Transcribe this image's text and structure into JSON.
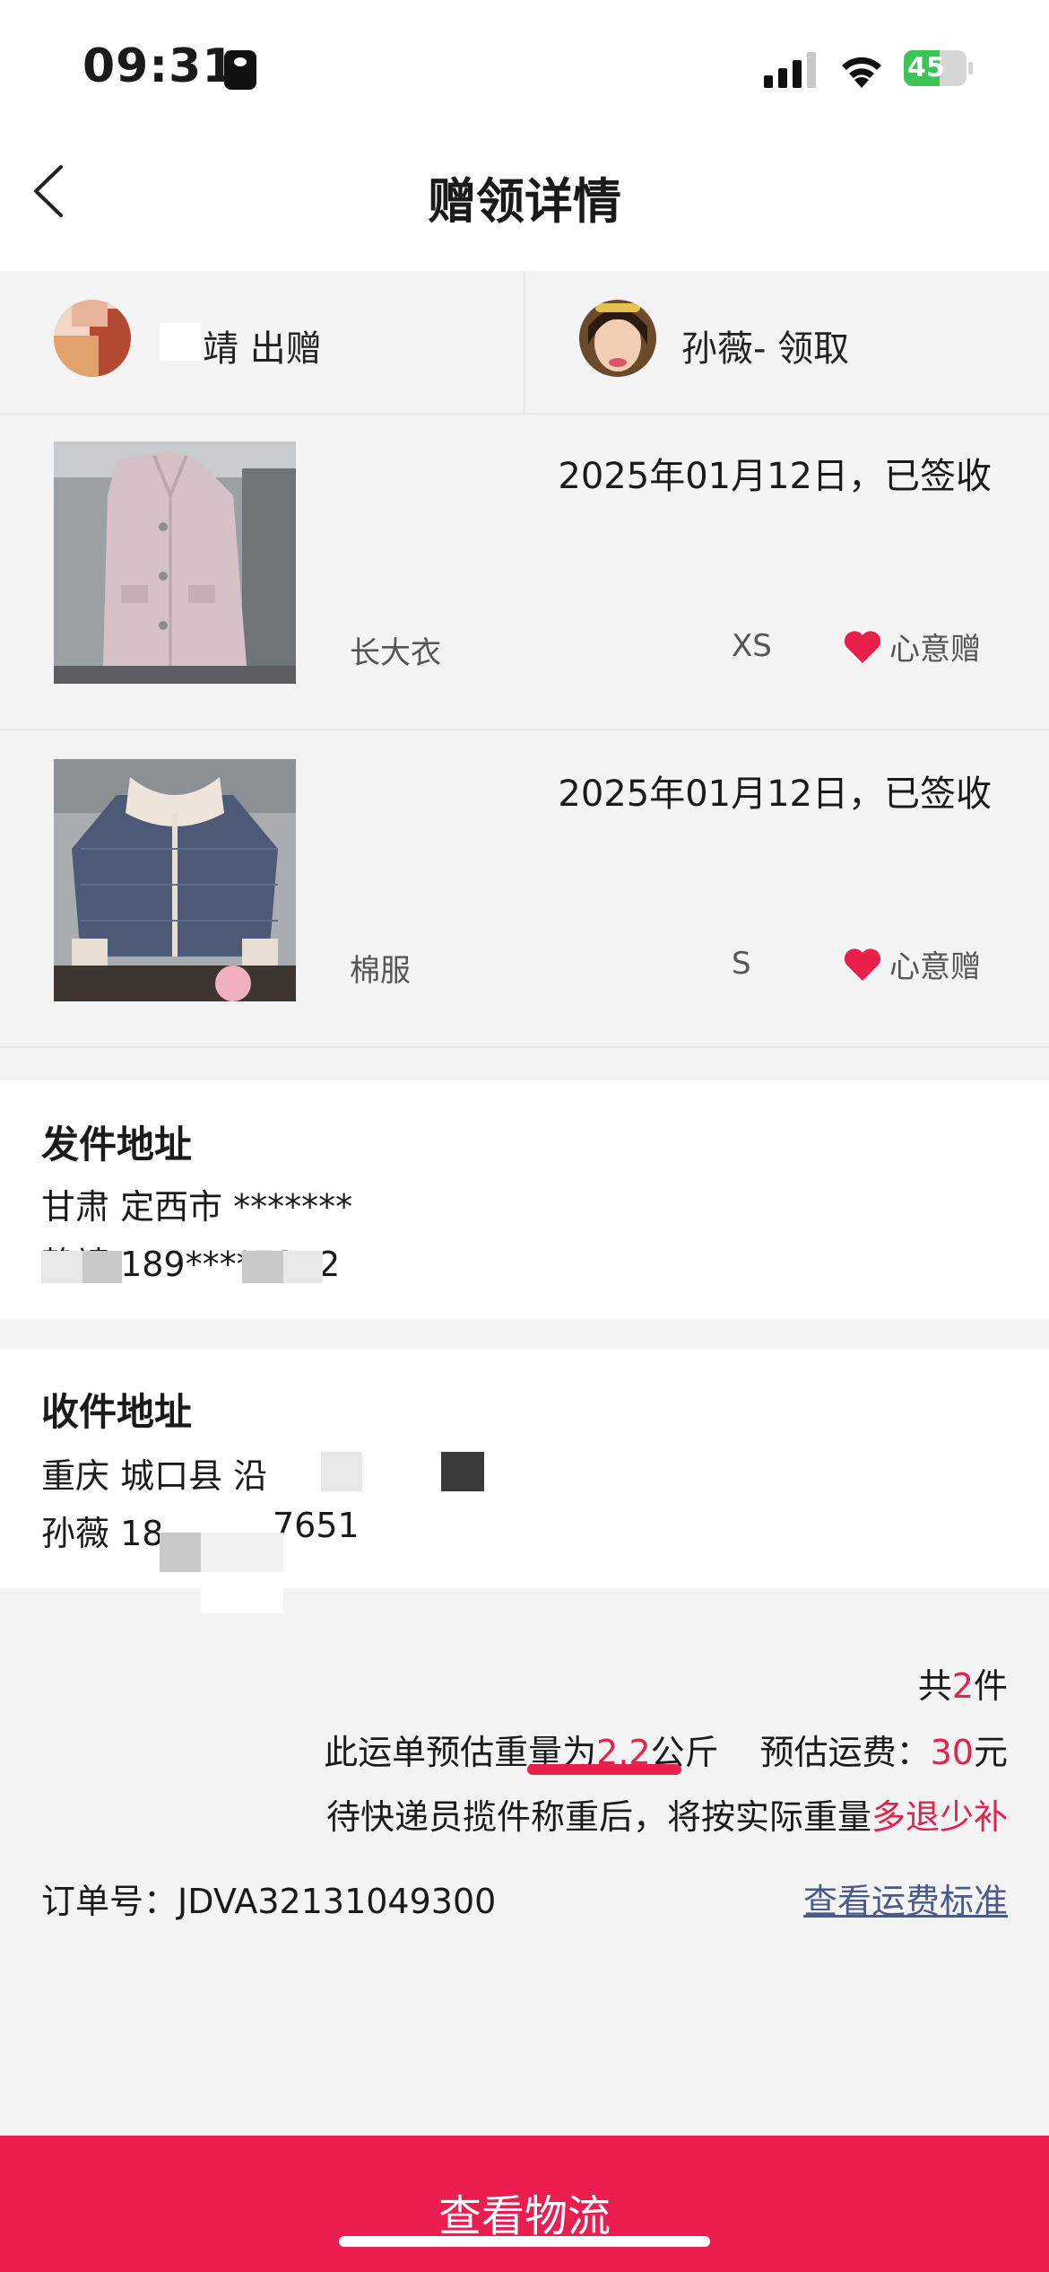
{
  "status": {
    "time": "09:31",
    "battery": "45"
  },
  "nav": {
    "title": "赠领详情"
  },
  "parties": {
    "giver_label": "靖 出赠",
    "receiver_label": "孙薇- 领取"
  },
  "items": [
    {
      "date_status": "2025年01月12日，已签收",
      "name": "长大衣",
      "size": "XS",
      "gift_label": "心意赠"
    },
    {
      "date_status": "2025年01月12日，已签收",
      "name": "棉服",
      "size": "S",
      "gift_label": "心意赠"
    }
  ],
  "sender": {
    "title": "发件地址",
    "region": "甘肃 定西市 *******",
    "contact": "静靖 189****7352"
  },
  "receiver": {
    "title": "收件地址",
    "region": "重庆 城口县 沿",
    "contact_prefix": "孙薇 18",
    "contact_suffix": "7651"
  },
  "summary": {
    "total_prefix": "共",
    "total_count": "2",
    "total_suffix": "件",
    "weight_prefix": "此运单预估重量为",
    "weight_value": "2.2",
    "weight_unit": "公斤",
    "fee_label": "预估运费：",
    "fee_value": "30",
    "fee_unit": "元",
    "note_prefix": "待快递员揽件称重后，将按实际重量",
    "note_highlight": "多退少补"
  },
  "order": {
    "label": "订单号：",
    "number": "JDVA32131049300"
  },
  "fee_link": "查看运费标准",
  "bottom_button": "查看物流",
  "colors": {
    "accent": "#ec1e4f",
    "link": "#4a5a8a"
  }
}
